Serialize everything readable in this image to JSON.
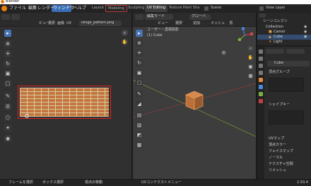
{
  "window": {
    "title": "Blender"
  },
  "menu": [
    "ファイル",
    "編集",
    "レンダー",
    "ウィンドウ",
    "ヘルプ"
  ],
  "workspaces": [
    "Layout",
    "Modeling",
    "Sculpting",
    "UV Editing",
    "Texture Paint",
    "Sha"
  ],
  "scene": {
    "label": "Scene",
    "view_layer": "View Layer"
  },
  "uv_editor": {
    "menus": [
      "ビュー",
      "選択",
      "画像",
      "UV"
    ],
    "image_name": "renga_pattern.png"
  },
  "viewport": {
    "mode_label": "編集モード",
    "view_label": "グローバ",
    "menus": [
      "ビュー",
      "選択",
      "追加",
      "メッシュ",
      "頂"
    ],
    "overlay_title": "ユーザー・透視投影",
    "overlay_object": "(1) Cube"
  },
  "outliner": {
    "title": "シーンコレクシ",
    "items": [
      "Collection",
      "Camer",
      "Cube",
      "Light"
    ]
  },
  "properties": {
    "object_name": "Cube",
    "sections": [
      "頂点グループ",
      "シェイプキー",
      "UVマップ",
      "頂点カラー",
      "フェイスマップ",
      "ノーマル",
      "テクスチャ空間",
      "リメッシュ"
    ]
  },
  "statusbar": {
    "items": [
      "フレームを選択",
      "ボックス選択",
      "視点の移動",
      "UVコンテクストメニュー"
    ],
    "version": "2.93.4"
  },
  "colors": {
    "accent": "#4772b3",
    "window_menu_highlight": "#3b6fb6",
    "texture_border": "#e02020",
    "brick": "#c4753c",
    "cube": "#c27a46"
  }
}
